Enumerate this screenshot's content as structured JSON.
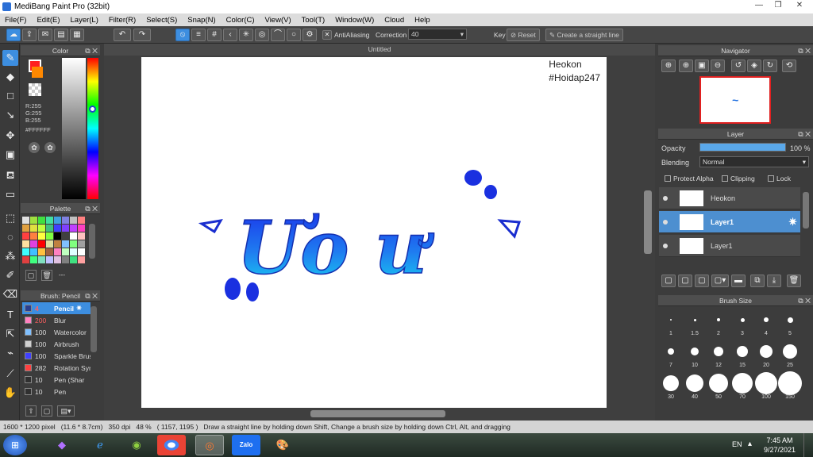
{
  "window": {
    "title": "MediBang Paint Pro (32bit)"
  },
  "menu": [
    "File(F)",
    "Edit(E)",
    "Layer(L)",
    "Filter(R)",
    "Select(S)",
    "Snap(N)",
    "Color(C)",
    "View(V)",
    "Tool(T)",
    "Window(W)",
    "Cloud",
    "Help"
  ],
  "toolbar": {
    "antialiasing_label": "AntiAliasing",
    "correction_label": "Correction",
    "correction_value": "40",
    "key_label": "Key",
    "reset_label": "Reset",
    "straight_line_label": "Create a straight line"
  },
  "color_panel": {
    "title": "Color",
    "r": "R:255",
    "g": "G:255",
    "b": "B:255",
    "hex": "#FFFFFF"
  },
  "palette_panel": {
    "title": "Palette",
    "dash": "---",
    "colors": [
      "#e0e0e0",
      "#a0e040",
      "#40e040",
      "#40e0a0",
      "#40a0e0",
      "#8080e0",
      "#c0c0c0",
      "#ff8080",
      "#e0a040",
      "#e0e040",
      "#c0ff40",
      "#40c080",
      "#4040ff",
      "#8040ff",
      "#c040ff",
      "#ff40c0",
      "#ff4040",
      "#ff8040",
      "#ffff40",
      "#80ff40",
      "#000000",
      "#404040",
      "#ffffff",
      "#ffc0c0",
      "#ffe0a0",
      "#e040e0",
      "#ff0000",
      "#e0e0a0",
      "#c08040",
      "#80c0ff",
      "#80ff80",
      "#a0a0a0",
      "#40ffff",
      "#40c0ff",
      "#ffc040",
      "#a06040",
      "#ff80c0",
      "#c0ffc0",
      "#e0ffff",
      "#ffffff",
      "#e04040",
      "#40ff80",
      "#80e0c0",
      "#c0c0ff",
      "#e0c0e0",
      "#808080",
      "#40e080",
      "#ffa0a0"
    ]
  },
  "brush_panel": {
    "title": "Brush: Pencil",
    "items": [
      {
        "size": "4",
        "name": "Pencil",
        "color": "#2a3f8f"
      },
      {
        "size": "200",
        "name": "Blur",
        "color": "#ff80c0"
      },
      {
        "size": "100",
        "name": "Watercolor",
        "color": "#80c0ff"
      },
      {
        "size": "100",
        "name": "Airbrush",
        "color": "#d0d0d0"
      },
      {
        "size": "100",
        "name": "Sparkle Brush",
        "color": "#4040ff"
      },
      {
        "size": "282",
        "name": "Rotation Sym",
        "color": "#ff4040"
      },
      {
        "size": "10",
        "name": "Pen (Shar",
        "color": "#303030"
      },
      {
        "size": "10",
        "name": "Pen",
        "color": "#303030"
      }
    ]
  },
  "document": {
    "tab_title": "Untitled",
    "signature_line1": "Heokon",
    "signature_line2": "#Hoidap247",
    "artwork_text": "Ưo ư"
  },
  "navigator": {
    "title": "Navigator"
  },
  "layer_panel": {
    "title": "Layer",
    "opacity_label": "Opacity",
    "opacity_value": "100 %",
    "opacity_fraction": 1.0,
    "blending_label": "Blending",
    "blending_value": "Normal",
    "protect_alpha": "Protect Alpha",
    "clipping": "Clipping",
    "lock": "Lock",
    "layers": [
      {
        "name": "Heokon",
        "selected": false
      },
      {
        "name": "Layer1",
        "selected": true
      },
      {
        "name": "Layer1",
        "selected": false
      }
    ]
  },
  "brush_size": {
    "title": "Brush Size",
    "sizes": [
      "1",
      "1.5",
      "2",
      "3",
      "4",
      "5",
      "7",
      "10",
      "12",
      "15",
      "20",
      "25",
      "30",
      "40",
      "50",
      "70",
      "100",
      "150"
    ]
  },
  "status": {
    "dimensions": "1600 * 1200 pixel",
    "physical": "(11.6 * 8.7cm)",
    "dpi": "350 dpi",
    "zoom": "48 %",
    "cursor": "( 1157, 1195 )",
    "hint": "Draw a straight line by holding down Shift, Change a brush size by holding down Ctrl, Alt, and dragging"
  },
  "taskbar": {
    "lang": "EN",
    "time": "7:45 AM",
    "date": "9/27/2021",
    "zalo_label": "Zalo"
  }
}
